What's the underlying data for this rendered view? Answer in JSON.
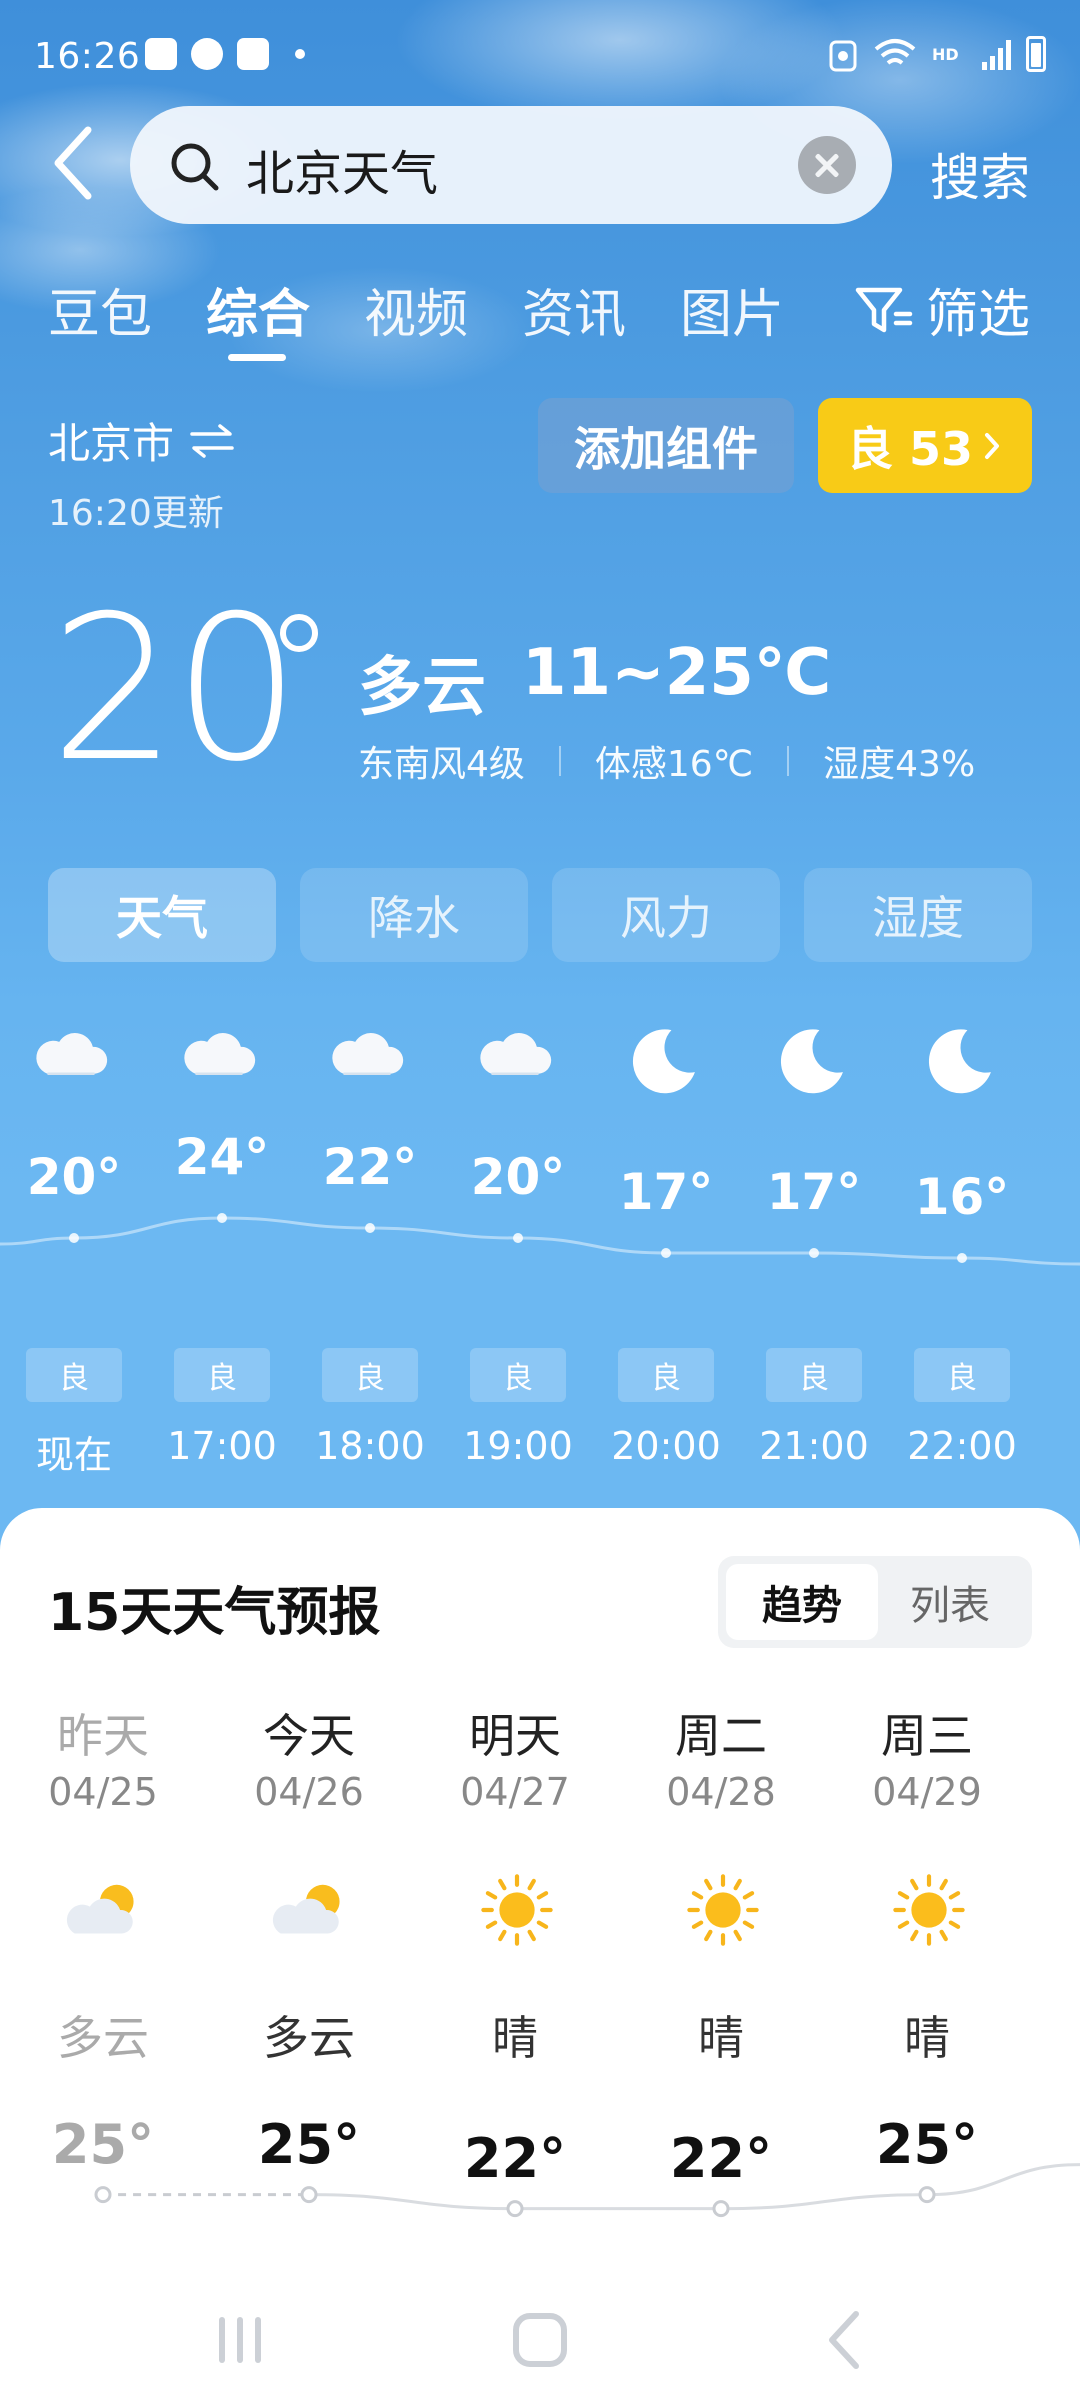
{
  "status_bar": {
    "time": "16:26"
  },
  "search": {
    "query": "北京天气",
    "button_label": "搜索"
  },
  "tabs": [
    "豆包",
    "综合",
    "视频",
    "资讯",
    "图片"
  ],
  "active_tab": "综合",
  "filter_label": "筛选",
  "location": {
    "city": "北京市",
    "updated": "16:20更新"
  },
  "add_widget_label": "添加组件",
  "aqi": {
    "label": "良 53"
  },
  "current": {
    "temp": "20",
    "condition": "多云",
    "range": "11~25℃",
    "wind": "东南风4级",
    "feels_like": "体感16℃",
    "humidity": "湿度43%"
  },
  "segments": [
    "天气",
    "降水",
    "风力",
    "湿度"
  ],
  "active_segment": "天气",
  "hourly": [
    {
      "time": "现在",
      "temp": "20°",
      "icon": "cloud-icon",
      "aqi": "良"
    },
    {
      "time": "17:00",
      "temp": "24°",
      "icon": "cloud-icon",
      "aqi": "良"
    },
    {
      "time": "18:00",
      "temp": "22°",
      "icon": "cloud-icon",
      "aqi": "良"
    },
    {
      "time": "19:00",
      "temp": "20°",
      "icon": "cloud-icon",
      "aqi": "良"
    },
    {
      "time": "20:00",
      "temp": "17°",
      "icon": "moon-icon",
      "aqi": "良"
    },
    {
      "time": "21:00",
      "temp": "17°",
      "icon": "moon-icon",
      "aqi": "良"
    },
    {
      "time": "22:00",
      "temp": "16°",
      "icon": "moon-icon",
      "aqi": "良"
    }
  ],
  "forecast": {
    "title": "15天天气预报",
    "view_toggle": [
      "趋势",
      "列表"
    ],
    "active_view": "趋势",
    "days": [
      {
        "name": "昨天",
        "date": "04/25",
        "icon": "partly-cloudy-icon",
        "condition": "多云",
        "high": "25°"
      },
      {
        "name": "今天",
        "date": "04/26",
        "icon": "partly-cloudy-icon",
        "condition": "多云",
        "high": "25°"
      },
      {
        "name": "明天",
        "date": "04/27",
        "icon": "sun-icon",
        "condition": "晴",
        "high": "22°"
      },
      {
        "name": "周二",
        "date": "04/28",
        "icon": "sun-icon",
        "condition": "晴",
        "high": "22°"
      },
      {
        "name": "周三",
        "date": "04/29",
        "icon": "sun-icon",
        "condition": "晴",
        "high": "25°"
      }
    ]
  }
}
